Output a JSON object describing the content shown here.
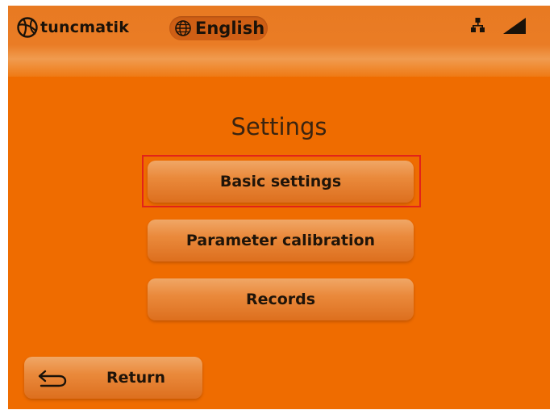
{
  "header": {
    "brand_name": "tuncmatik",
    "logo_icon": "tuncmatik-logo-icon",
    "language": {
      "icon": "globe-icon",
      "label": "English"
    },
    "status_icons": [
      "network-icon",
      "signal-strength-icon"
    ]
  },
  "main": {
    "title": "Settings",
    "menu": [
      {
        "label": "Basic settings",
        "selected": true
      },
      {
        "label": "Parameter calibration",
        "selected": false
      },
      {
        "label": "Records",
        "selected": false
      }
    ],
    "return_button": {
      "label": "Return",
      "icon": "return-arrow-icon"
    }
  },
  "colors": {
    "background": "#ef6c00",
    "button": "#ea8a3c",
    "selection_outline": "#e2231a",
    "text": "#1f1409"
  }
}
